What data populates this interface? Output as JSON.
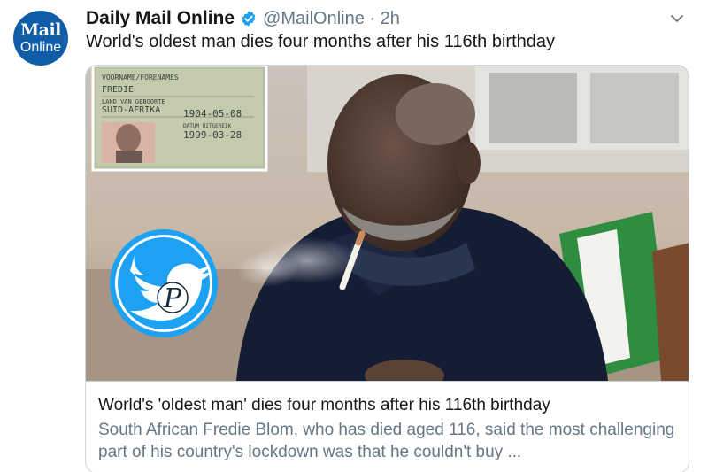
{
  "avatar": {
    "line1": "Mail",
    "line2": "Online"
  },
  "tweet": {
    "author": "Daily Mail Online",
    "handle_time": "@MailOnline · 2h",
    "text": "World's oldest man dies four months after his 116th birthday"
  },
  "card": {
    "id_document": {
      "name": "FREDIE",
      "country": "SUID-AFRIKA",
      "birth_date": "1904-05-08",
      "issue_date": "1999-03-28"
    },
    "watermark_letter": "P",
    "title": "World's 'oldest man' dies four months after his 116th birthday",
    "description": "South African Fredie Blom, who has died aged 116, said the most challenging part of his country's lockdown was that he couldn't buy ..."
  },
  "colors": {
    "brand_blue": "#0f5da8",
    "verified_blue": "#1da1f2",
    "text": "#14171a",
    "muted": "#657786",
    "twitter_watermark": "#1da1f2"
  },
  "icons": [
    "verified-badge-icon",
    "chevron-down-icon",
    "twitter-bird-icon"
  ]
}
